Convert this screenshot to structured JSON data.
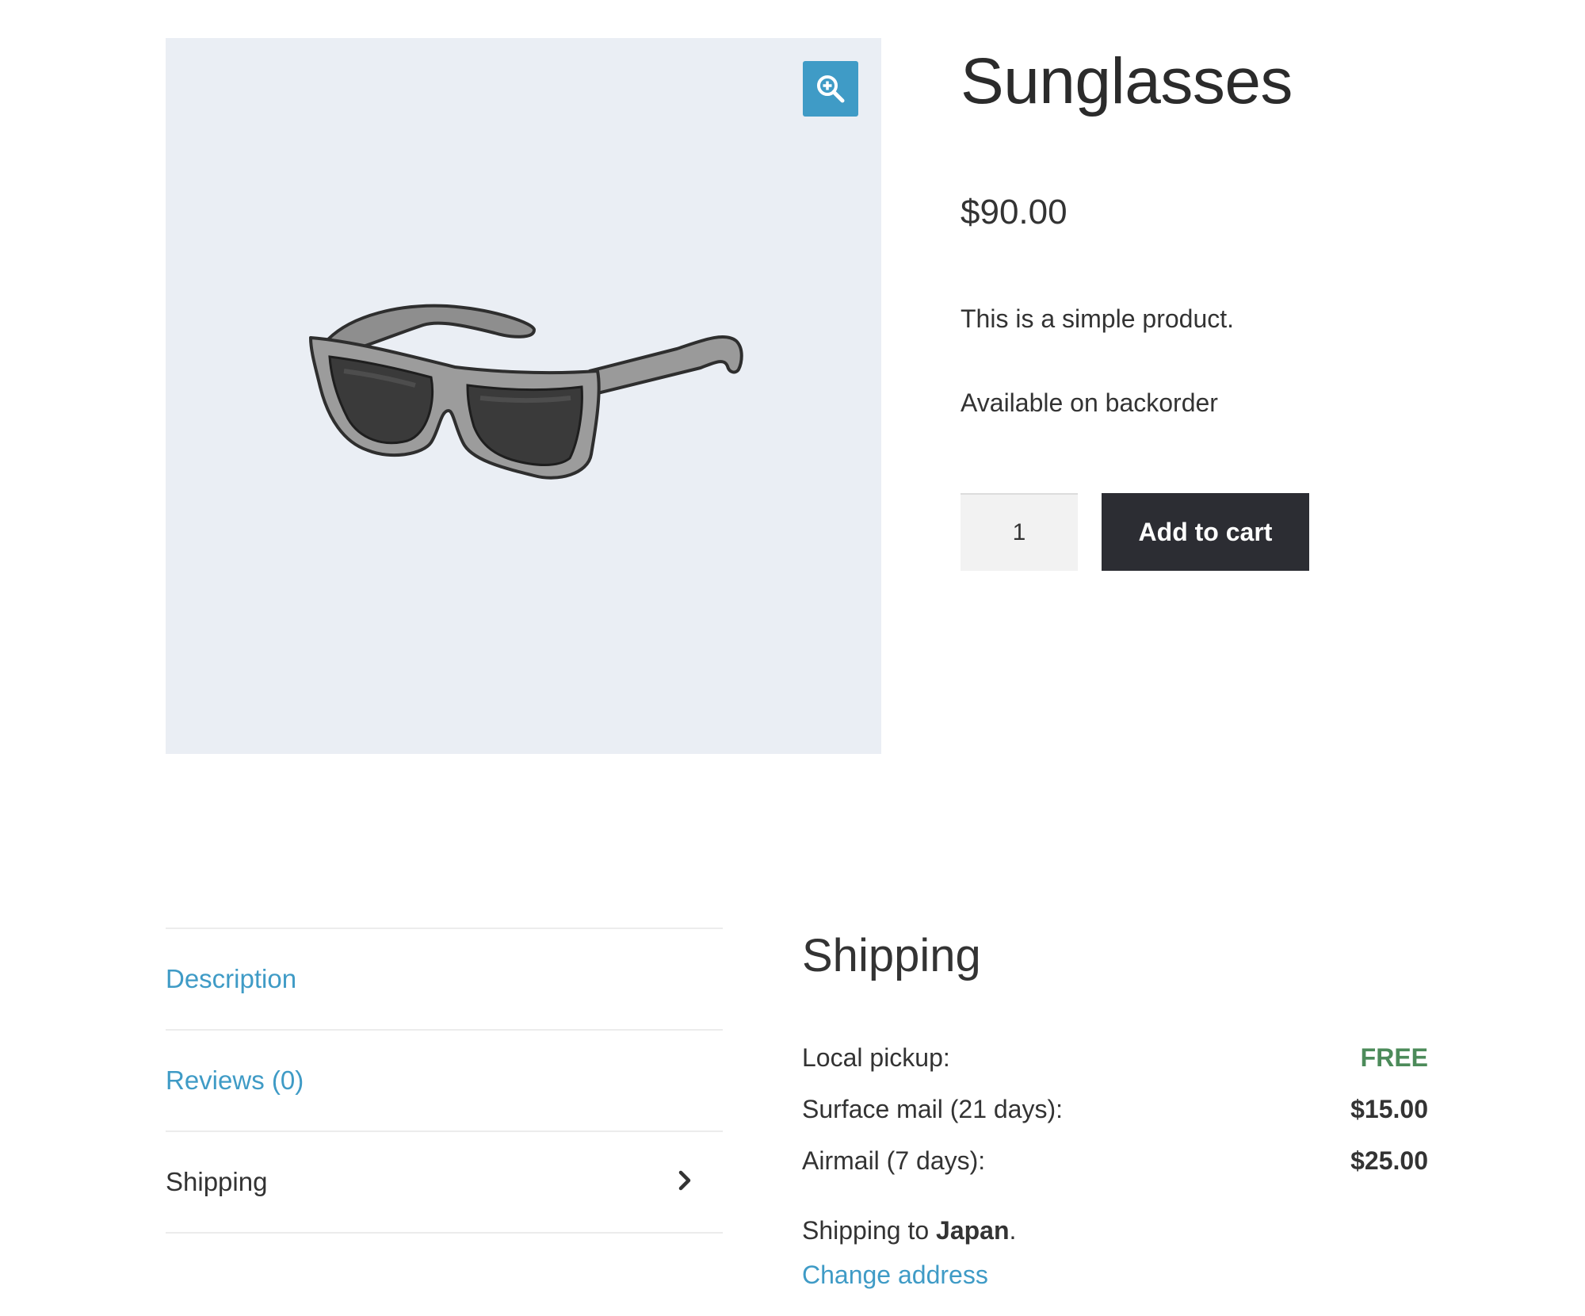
{
  "product": {
    "title": "Sunglasses",
    "price": "$90.00",
    "short_description": "This is a simple product.",
    "stock_status": "Available on backorder",
    "quantity": "1",
    "add_to_cart_label": "Add to cart",
    "image_icon": "sunglasses-image",
    "zoom_icon": "zoom-in-icon"
  },
  "tabs": [
    {
      "label": "Description",
      "active": false
    },
    {
      "label": "Reviews (0)",
      "active": false
    },
    {
      "label": "Shipping",
      "active": true
    }
  ],
  "shipping": {
    "title": "Shipping",
    "rates": [
      {
        "name": "Local pickup:",
        "cost": "FREE"
      },
      {
        "name": "Surface mail (21 days):",
        "cost": "$15.00"
      },
      {
        "name": "Airmail (7 days):",
        "cost": "$25.00"
      }
    ],
    "destination_prefix": "Shipping to ",
    "destination_country": "Japan",
    "destination_suffix": ".",
    "change_address_label": "Change address"
  },
  "colors": {
    "link": "#3f9bc6",
    "button": "#2c2d33",
    "free": "#4c8b5a",
    "image_bg": "#eaeef4"
  }
}
